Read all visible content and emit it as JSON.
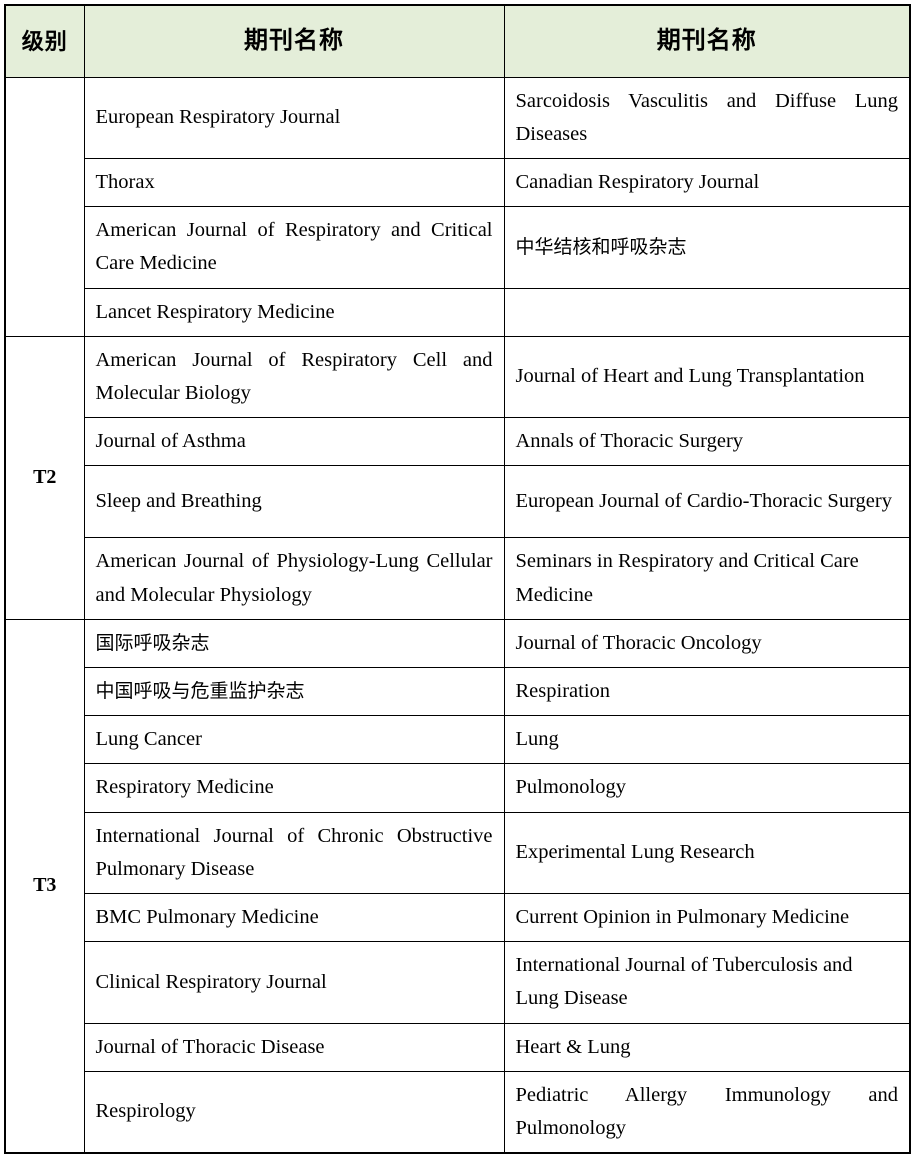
{
  "table": {
    "headers": {
      "level": "级别",
      "col1": "期刊名称",
      "col2": "期刊名称"
    },
    "header_bg": "#e4eed9",
    "border_color": "#000000",
    "groups": [
      {
        "level": "",
        "rows": [
          {
            "left": "European Respiratory Journal",
            "right": "Sarcoidosis Vasculitis and Diffuse Lung Diseases"
          },
          {
            "left": "Thorax",
            "right": "Canadian Respiratory Journal"
          },
          {
            "left": "American Journal of Respiratory and Critical Care Medicine",
            "right": "中华结核和呼吸杂志"
          },
          {
            "left": "Lancet Respiratory Medicine",
            "right": ""
          }
        ]
      },
      {
        "level": "T2",
        "rows": [
          {
            "left": "American Journal of Respiratory Cell and Molecular Biology",
            "right": "Journal of Heart and Lung Transplantation"
          },
          {
            "left": "Journal of Asthma",
            "right": "Annals of Thoracic Surgery"
          },
          {
            "left": "Sleep and Breathing",
            "right": "European Journal of Cardio-Thoracic Surgery"
          },
          {
            "left": "American Journal of Physiology-Lung Cellular and Molecular Physiology",
            "right": "Seminars in Respiratory and Critical Care Medicine"
          }
        ]
      },
      {
        "level": "T3",
        "rows": [
          {
            "left": "国际呼吸杂志",
            "right": "Journal of Thoracic Oncology"
          },
          {
            "left": "中国呼吸与危重监护杂志",
            "right": "Respiration"
          },
          {
            "left": "Lung Cancer",
            "right": "Lung"
          },
          {
            "left": "Respiratory Medicine",
            "right": "Pulmonology"
          },
          {
            "left": "International Journal of Chronic Obstructive Pulmonary Disease",
            "right": "Experimental Lung Research"
          },
          {
            "left": "BMC Pulmonary Medicine",
            "right": "Current Opinion in Pulmonary Medicine"
          },
          {
            "left": "Clinical Respiratory Journal",
            "right": "International Journal of Tuberculosis and Lung Disease"
          },
          {
            "left": "Journal of Thoracic Disease",
            "right": "Heart & Lung"
          },
          {
            "left": "Respirology",
            "right": "Pediatric Allergy Immunology and Pulmonology"
          }
        ]
      }
    ]
  }
}
